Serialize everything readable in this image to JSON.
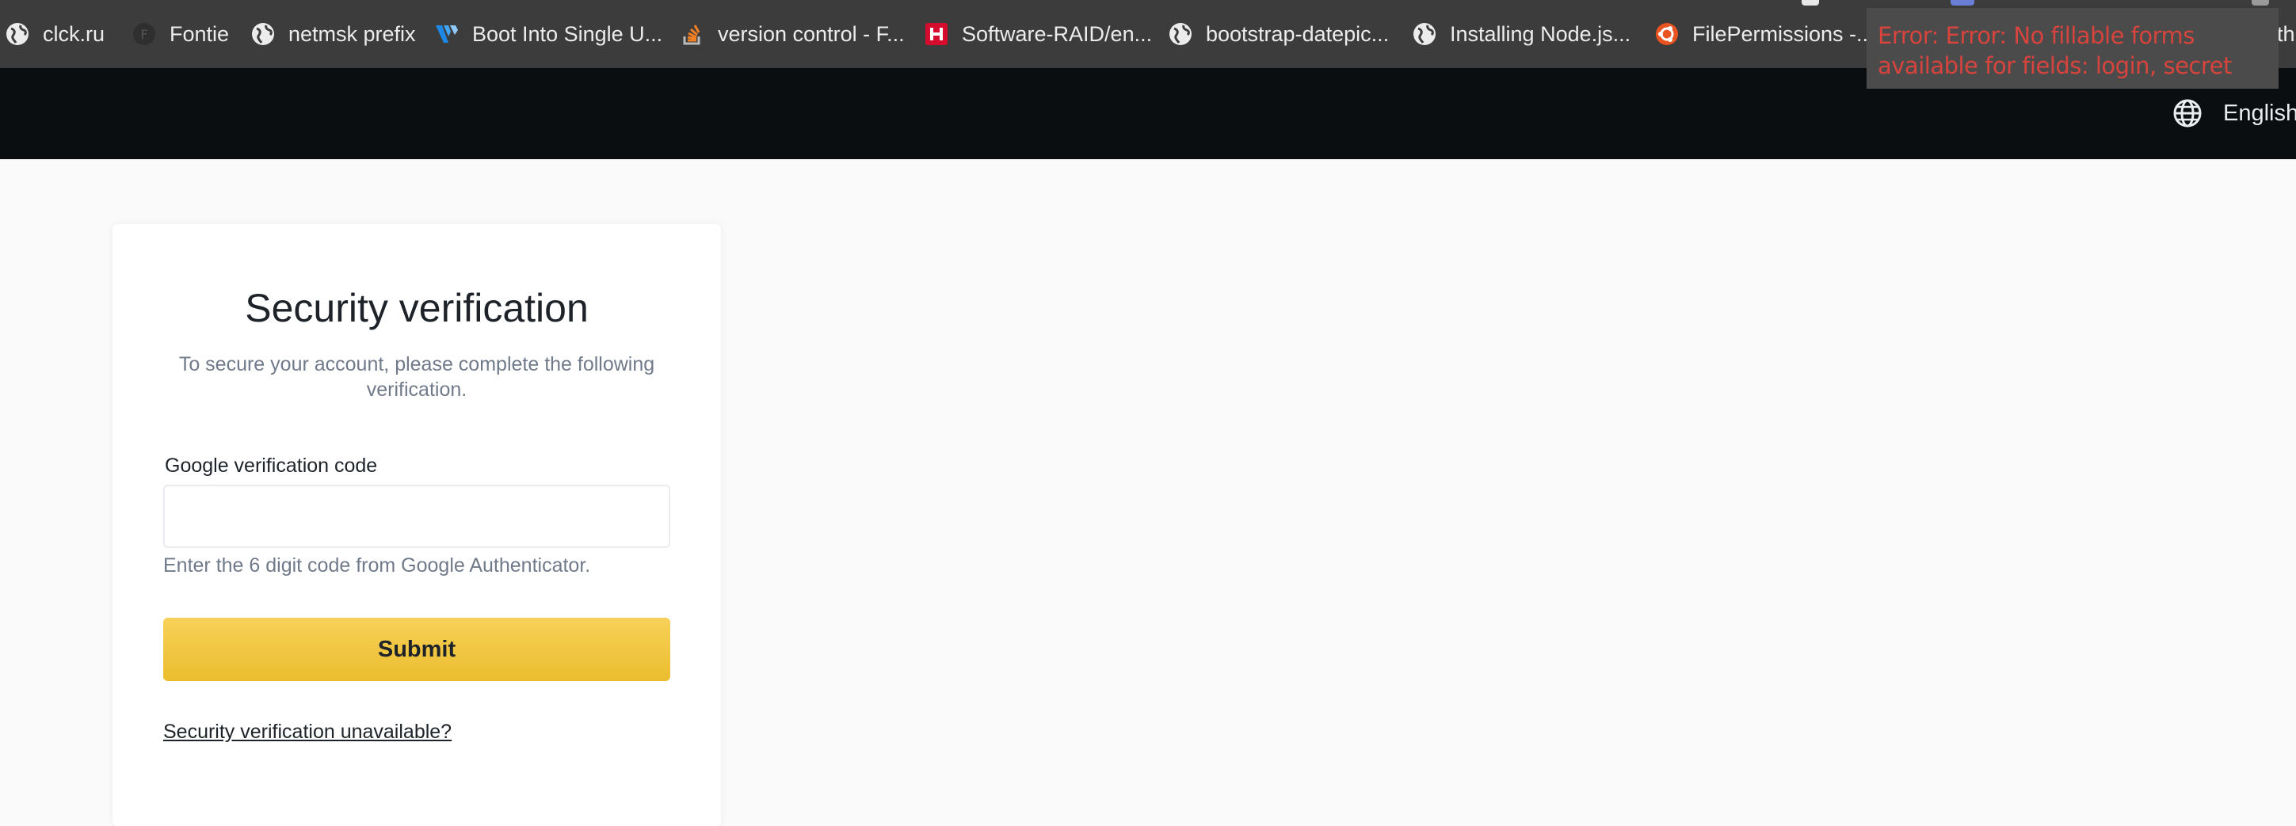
{
  "bookmarks": [
    {
      "label": "clck.ru",
      "icon": "globe-icon"
    },
    {
      "label": "Fontie",
      "icon": "fontie-icon"
    },
    {
      "label": "netmsk prefix",
      "icon": "globe-icon"
    },
    {
      "label": "Boot Into Single U...",
      "icon": "vultr-icon"
    },
    {
      "label": "version control - F...",
      "icon": "stackoverflow-icon"
    },
    {
      "label": "Software-RAID/en...",
      "icon": "hetzner-icon"
    },
    {
      "label": "bootstrap-datepic...",
      "icon": "globe-icon"
    },
    {
      "label": "Installing Node.js...",
      "icon": "globe-icon"
    },
    {
      "label": "FilePermissions -...",
      "icon": "ubuntu-icon"
    }
  ],
  "bookmarks_overflow_text": "th",
  "error_tooltip": {
    "text": "Error: Error: No fillable forms available for fields: login, secret",
    "color": "#d6443d"
  },
  "header": {
    "language_label": "English",
    "language_icon": "globe-icon",
    "background": "#0b0e11"
  },
  "verification": {
    "title": "Security verification",
    "subtitle": "To secure your account, please complete the following verification.",
    "field_label": "Google verification code",
    "field_value": "",
    "field_placeholder": "",
    "hint": "Enter the 6 digit code from Google Authenticator.",
    "submit_label": "Submit",
    "unavailable_link": "Security verification unavailable?",
    "accent_color": "#f0c232"
  }
}
